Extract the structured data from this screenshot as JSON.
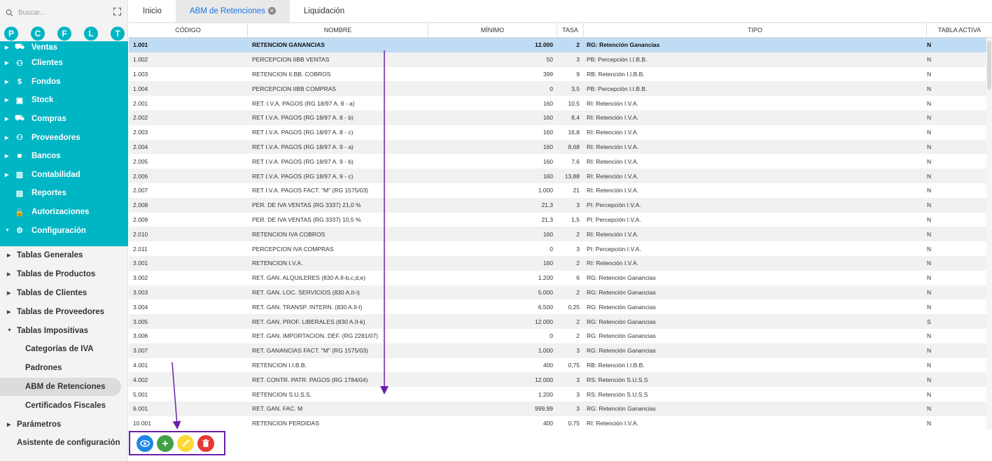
{
  "search": {
    "placeholder": "Buscar..."
  },
  "letters": [
    "P",
    "C",
    "F",
    "L",
    "T"
  ],
  "menu": [
    {
      "label": "Ventas",
      "icon": "cart-icon",
      "glyph": "🛒"
    },
    {
      "label": "Clientes",
      "icon": "people-icon",
      "glyph": "👥"
    },
    {
      "label": "Fondos",
      "icon": "dollar-icon",
      "glyph": "$"
    },
    {
      "label": "Stock",
      "icon": "box-icon",
      "glyph": "▣"
    },
    {
      "label": "Compras",
      "icon": "cart-outline-icon",
      "glyph": "🛒"
    },
    {
      "label": "Proveedores",
      "icon": "people-icon",
      "glyph": "👥"
    },
    {
      "label": "Bancos",
      "icon": "briefcase-icon",
      "glyph": "■"
    },
    {
      "label": "Contabilidad",
      "icon": "book-icon",
      "glyph": "▥"
    },
    {
      "label": "Reportes",
      "icon": "report-icon",
      "glyph": "▤"
    },
    {
      "label": "Autorizaciones",
      "icon": "lock-icon",
      "glyph": "🔒"
    },
    {
      "label": "Configuración",
      "icon": "settings-icon",
      "glyph": "⚙"
    }
  ],
  "submenu": [
    {
      "label": "Tablas Generales"
    },
    {
      "label": "Tablas de Productos"
    },
    {
      "label": "Tablas de Clientes"
    },
    {
      "label": "Tablas de Proveedores"
    },
    {
      "label": "Tablas Impositivas"
    },
    {
      "label": "Categorías de IVA"
    },
    {
      "label": "Padrones"
    },
    {
      "label": "ABM de Retenciones"
    },
    {
      "label": "Certificados Fiscales"
    },
    {
      "label": "Parámetros"
    },
    {
      "label": "Asistente de configuración"
    }
  ],
  "tabs": [
    {
      "label": "Inicio"
    },
    {
      "label": "ABM de Retenciones"
    },
    {
      "label": "Liquidación"
    }
  ],
  "columns": [
    "CÓDIGO",
    "NOMBRE",
    "MÍNIMO",
    "TASA",
    "TIPO",
    "TABLA ACTIVA"
  ],
  "rows": [
    [
      "1.001",
      "RETENCION GANANCIAS",
      "12.000",
      "2",
      "RG: Retención Ganancias",
      "N"
    ],
    [
      "1.002",
      "PERCEPCION IIBB VENTAS",
      "50",
      "3",
      "PB: Percepción I.I.B.B.",
      "N"
    ],
    [
      "1.003",
      "RETENCION II.BB. COBROS",
      "399",
      "9",
      "RB: Retención I.I.B.B.",
      "N"
    ],
    [
      "1.004",
      "PERCEPCION IIBB COMPRAS",
      "0",
      "3,5",
      "PB: Percepción I.I.B.B.",
      "N"
    ],
    [
      "2.001",
      "RET. I.V.A. PAGOS (RG 18/97 A. 8 - a)",
      "160",
      "10,5",
      "RI: Retención I.V.A.",
      "N"
    ],
    [
      "2.002",
      "RET I.V.A. PAGOS (RG 18/97 A. 8 - b)",
      "160",
      "8,4",
      "RI: Retención I.V.A.",
      "N"
    ],
    [
      "2.003",
      "RET I.V.A. PAGOS (RG 18/97 A. 8 - c)",
      "160",
      "16,8",
      "RI: Retención I.V.A.",
      "N"
    ],
    [
      "2.004",
      "RET I.V.A. PAGOS (RG 18/97 A. 9 - a)",
      "160",
      "8,68",
      "RI: Retención I.V.A.",
      "N"
    ],
    [
      "2.005",
      "RET I.V.A. PAGOS (RG 18/97 A. 9 - b)",
      "160",
      "7,6",
      "RI: Retención I.V.A.",
      "N"
    ],
    [
      "2.006",
      "RET I.V.A. PAGOS (RG 18/97 A. 9 - c)",
      "160",
      "13,88",
      "RI: Retención I.V.A.",
      "N"
    ],
    [
      "2.007",
      "RET I.V.A. PAGOS FACT. \"M\" (RG 1575/03)",
      "1.000",
      "21",
      "RI: Retención I.V.A.",
      "N"
    ],
    [
      "2.008",
      "PER. DE IVA VENTAS (RG 3337) 21,0 %",
      "21,3",
      "3",
      "PI: Percepción I.V.A.",
      "N"
    ],
    [
      "2.009",
      "PER. DE IVA VENTAS (RG 3337) 10,5 %",
      "21,3",
      "1,5",
      "PI: Percepción I.V.A.",
      "N"
    ],
    [
      "2.010",
      "RETENCION IVA COBROS",
      "160",
      "2",
      "RI: Retención I.V.A.",
      "N"
    ],
    [
      "2.011",
      "PERCEPCION IVA COMPRAS",
      "0",
      "3",
      "PI: Percepción I.V.A.",
      "N"
    ],
    [
      "3.001",
      "RETENCION I.V.A.",
      "160",
      "2",
      "RI: Retención I.V.A.",
      "N"
    ],
    [
      "3.002",
      "RET. GAN. ALQUILERES (830 A.II-b,c,d,e)",
      "1.200",
      "6",
      "RG: Retención Ganancias",
      "N"
    ],
    [
      "3.003",
      "RET. GAN. LOC. SERVICIOS (830 A.II-i)",
      "5.000",
      "2",
      "RG: Retención Ganancias",
      "N"
    ],
    [
      "3.004",
      "RET. GAN. TRANSP. INTERN. (830 A.II-l)",
      "6.500",
      "0,25",
      "RG: Retención Ganancias",
      "N"
    ],
    [
      "3.005",
      "RET. GAN. PROF. LIBERALES (830 A.II-k)",
      "12.000",
      "2",
      "RG: Retención Ganancias",
      "S"
    ],
    [
      "3.006",
      "RET. GAN. IMPORTACION. DEF. (RG 2281/07)",
      "0",
      "2",
      "RG: Retención Ganancias",
      "N"
    ],
    [
      "3.007",
      "RET. GANANCIAS FACT. \"M\" (RG 1575/03)",
      "1.000",
      "3",
      "RG: Retención Ganancias",
      "N"
    ],
    [
      "4.001",
      "RETENCION I.I.B.B.",
      "400",
      "0,75",
      "RB: Retención I.I.B.B.",
      "N"
    ],
    [
      "4.002",
      "RET. CONTR. PATR. PAGOS (RG 1784/04)",
      "12.000",
      "3",
      "RS: Retención S.U.S.S",
      "N"
    ],
    [
      "5.001",
      "RETENCION S.U.S.S.",
      "1.200",
      "3",
      "RS: Retención S.U.S.S",
      "N"
    ],
    [
      "6.001",
      "RET. GAN. FAC. M",
      "999,99",
      "3",
      "RG: Retención Ganancias",
      "N"
    ],
    [
      "10.001",
      "RETENCION PERDIDAS",
      "400",
      "0,75",
      "RI: Retención I.V.A.",
      "N"
    ]
  ],
  "actions": [
    {
      "name": "view-button",
      "icon": "eye-icon",
      "glyph": "◉",
      "cls": "view"
    },
    {
      "name": "add-button",
      "icon": "plus-icon",
      "glyph": "+",
      "cls": "add"
    },
    {
      "name": "edit-button",
      "icon": "pencil-icon",
      "glyph": "✎",
      "cls": "edit"
    },
    {
      "name": "delete-button",
      "icon": "trash-icon",
      "glyph": "🗑",
      "cls": "del"
    }
  ],
  "colors": {
    "accent": "#00b5c4",
    "selected_row": "#c0dcf5",
    "tab_active_text": "#1a73e8",
    "annotation": "#6a1fa8"
  }
}
